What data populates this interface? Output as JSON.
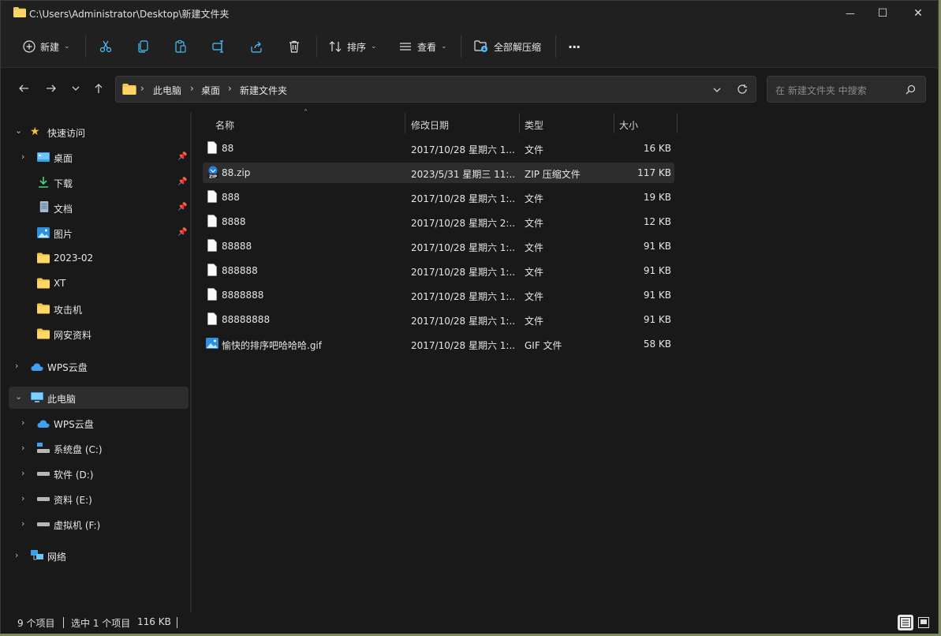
{
  "window": {
    "title": "C:\\Users\\Administrator\\Desktop\\新建文件夹",
    "minimize_glyph": "—",
    "maximize_glyph": "☐",
    "close_glyph": "✕"
  },
  "toolbar": {
    "new_label": "新建",
    "sort_label": "排序",
    "view_label": "查看",
    "extract_label": "全部解压缩",
    "more_label": "···",
    "icons": [
      "plus-circle-icon",
      "cut-icon",
      "copy-icon",
      "paste-icon",
      "rename-icon",
      "share-icon",
      "delete-icon",
      "sort-icon",
      "view-icon",
      "extract-icon",
      "more-icon"
    ]
  },
  "address": {
    "breadcrumbs": [
      "此电脑",
      "桌面",
      "新建文件夹"
    ],
    "separator": "›"
  },
  "search": {
    "placeholder": "在 新建文件夹 中搜索"
  },
  "sidebar": {
    "quick_access": "快速访问",
    "quick_items": [
      {
        "label": "桌面",
        "icon": "desktop-icon",
        "pinned": true
      },
      {
        "label": "下载",
        "icon": "download-icon",
        "pinned": true
      },
      {
        "label": "文档",
        "icon": "document-icon",
        "pinned": true
      },
      {
        "label": "图片",
        "icon": "pictures-icon",
        "pinned": true
      },
      {
        "label": "2023-02",
        "icon": "folder-icon",
        "pinned": false
      },
      {
        "label": "XT",
        "icon": "folder-icon",
        "pinned": false
      },
      {
        "label": "攻击机",
        "icon": "folder-icon",
        "pinned": false
      },
      {
        "label": "网安资料",
        "icon": "folder-icon",
        "pinned": false
      }
    ],
    "wps_cloud": "WPS云盘",
    "this_pc": "此电脑",
    "pc_items": [
      {
        "label": "WPS云盘",
        "icon": "cloud-icon"
      },
      {
        "label": "系统盘 (C:)",
        "icon": "system-drive-icon"
      },
      {
        "label": "软件 (D:)",
        "icon": "drive-icon"
      },
      {
        "label": "资料 (E:)",
        "icon": "drive-icon"
      },
      {
        "label": "虚拟机 (F:)",
        "icon": "drive-icon"
      }
    ],
    "network": "网络"
  },
  "columns": {
    "name": "名称",
    "modified": "修改日期",
    "type": "类型",
    "size": "大小"
  },
  "files": [
    {
      "name": "88",
      "modified": "2017/10/28 星期六 1...",
      "type": "文件",
      "size": "16 KB",
      "icon": "file-icon",
      "selected": false
    },
    {
      "name": "88.zip",
      "modified": "2023/5/31 星期三 11:...",
      "type": "ZIP 压缩文件",
      "size": "117 KB",
      "icon": "zip-icon",
      "selected": true
    },
    {
      "name": "888",
      "modified": "2017/10/28 星期六 1:...",
      "type": "文件",
      "size": "19 KB",
      "icon": "file-icon",
      "selected": false
    },
    {
      "name": "8888",
      "modified": "2017/10/28 星期六 2:...",
      "type": "文件",
      "size": "12 KB",
      "icon": "file-icon",
      "selected": false
    },
    {
      "name": "88888",
      "modified": "2017/10/28 星期六 1:...",
      "type": "文件",
      "size": "91 KB",
      "icon": "file-icon",
      "selected": false
    },
    {
      "name": "888888",
      "modified": "2017/10/28 星期六 1:...",
      "type": "文件",
      "size": "91 KB",
      "icon": "file-icon",
      "selected": false
    },
    {
      "name": "8888888",
      "modified": "2017/10/28 星期六 1:...",
      "type": "文件",
      "size": "91 KB",
      "icon": "file-icon",
      "selected": false
    },
    {
      "name": "88888888",
      "modified": "2017/10/28 星期六 1:...",
      "type": "文件",
      "size": "91 KB",
      "icon": "file-icon",
      "selected": false
    },
    {
      "name": "愉快的排序吧哈哈哈.gif",
      "modified": "2017/10/28 星期六 1:...",
      "type": "GIF 文件",
      "size": "58 KB",
      "icon": "image-file-icon",
      "selected": false
    }
  ],
  "status": {
    "count": "9 个项目",
    "selection": "选中 1 个项目",
    "selection_size": "116 KB"
  },
  "colors": {
    "folder": "#f4c44e",
    "accent": "#4cc2ff",
    "window_bg": "#191919"
  }
}
